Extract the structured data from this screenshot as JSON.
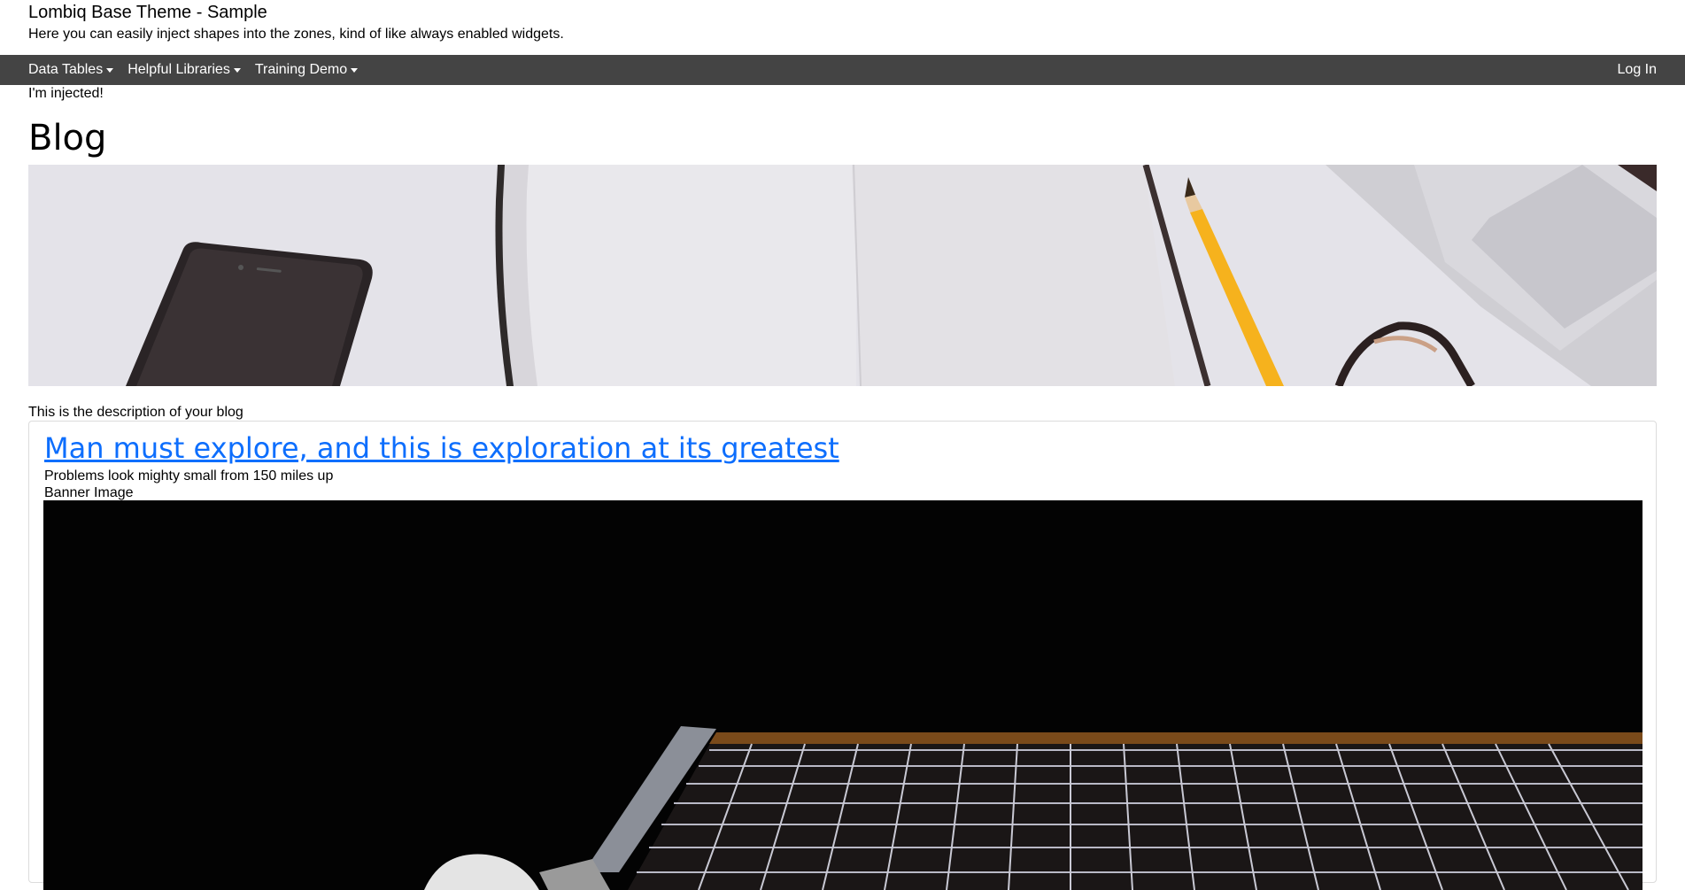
{
  "site": {
    "title": "Lombiq Base Theme - Sample",
    "tagline": "Here you can easily inject shapes into the zones, kind of like always enabled widgets."
  },
  "nav": {
    "items": [
      {
        "label": "Data Tables"
      },
      {
        "label": "Helpful Libraries"
      },
      {
        "label": "Training Demo"
      }
    ],
    "login": "Log In"
  },
  "injected_text": "I'm injected!",
  "page": {
    "title": "Blog",
    "description": "This is the description of your blog"
  },
  "post": {
    "title": "Man must explore, and this is exploration at its greatest",
    "subtitle": "Problems look mighty small from 150 miles up",
    "banner_label": "Banner Image"
  },
  "colors": {
    "navbar": "#444444",
    "link": "#0d6efd"
  }
}
